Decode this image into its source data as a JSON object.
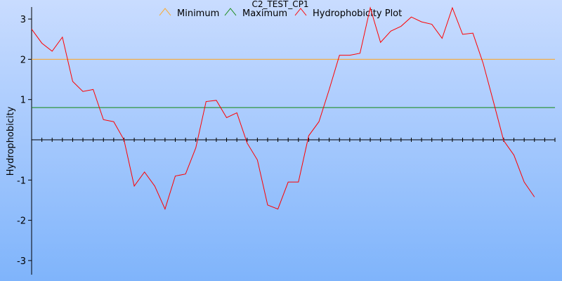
{
  "chart_data": {
    "type": "line",
    "title": "C2_TEST_CP1",
    "ylabel": "Hydrophobicity",
    "xlabel": "",
    "ylim": [
      -3.3,
      3.3
    ],
    "yticks": [
      3,
      2,
      1,
      -1,
      -2,
      -3
    ],
    "yticks_text": [
      "3",
      "2",
      "1",
      "-1",
      "-2",
      "-3"
    ],
    "xlim": [
      0,
      51
    ],
    "x_tick_count": 51,
    "grid": false,
    "legend_position": "top",
    "series": [
      {
        "name": "Minimum",
        "color": "#ffa520",
        "constant": 2.0
      },
      {
        "name": "Maximum",
        "color": "#118811",
        "constant": 0.8
      },
      {
        "name": "Hydrophobicity Plot",
        "color": "#ff0000",
        "values": [
          2.75,
          2.4,
          2.2,
          2.55,
          1.45,
          1.2,
          1.25,
          0.5,
          0.45,
          0.0,
          -1.15,
          -0.8,
          -1.15,
          -1.72,
          -0.9,
          -0.85,
          -0.2,
          0.95,
          0.98,
          0.55,
          0.67,
          -0.08,
          -0.5,
          -1.62,
          -1.72,
          -1.05,
          -1.05,
          0.1,
          0.45,
          1.25,
          2.1,
          2.1,
          2.15,
          3.28,
          2.42,
          2.7,
          2.82,
          3.05,
          2.93,
          2.87,
          2.52,
          3.28,
          2.62,
          2.65,
          1.9,
          0.95,
          -0.02,
          -0.38,
          -1.05,
          -1.42
        ]
      }
    ]
  }
}
